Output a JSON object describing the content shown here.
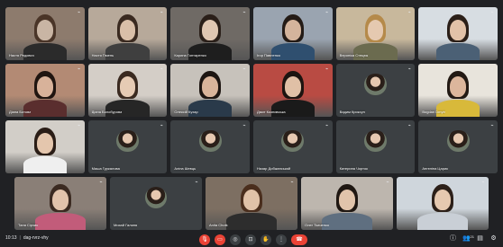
{
  "meeting": {
    "time": "10:13",
    "separator": "|",
    "code": "dag-rvrz-vhy",
    "participants_count": "21"
  },
  "participants": [
    {
      "name": "Настя Редович",
      "muted": true,
      "type": "video"
    },
    {
      "name": "Настя Гімень",
      "muted": true,
      "type": "video"
    },
    {
      "name": "Карина Гоптаренко",
      "muted": true,
      "type": "video"
    },
    {
      "name": "Ігор Павленко",
      "muted": true,
      "type": "video"
    },
    {
      "name": "Вероніка Стецюк",
      "muted": true,
      "type": "video"
    },
    {
      "name": "",
      "muted": true,
      "type": "video"
    },
    {
      "name": "Діана Ботова",
      "muted": true,
      "type": "video"
    },
    {
      "name": "Діана Болобурова",
      "muted": true,
      "type": "video"
    },
    {
      "name": "Олексій Кухар",
      "muted": true,
      "type": "video"
    },
    {
      "name": "Дмит Кознивська",
      "muted": true,
      "type": "video"
    },
    {
      "name": "Вадим Криксун",
      "muted": true,
      "type": "avatar"
    },
    {
      "name": "Bogdan Dmytr",
      "muted": true,
      "type": "video"
    },
    {
      "name": "",
      "muted": true,
      "type": "video"
    },
    {
      "name": "Маша Гуркалова",
      "muted": true,
      "type": "avatar"
    },
    {
      "name": "Аліна Шевць",
      "muted": true,
      "type": "avatar"
    },
    {
      "name": "Назар Добжанський",
      "muted": true,
      "type": "avatar"
    },
    {
      "name": "Катерина Чорток",
      "muted": true,
      "type": "avatar"
    },
    {
      "name": "Ангеліна Царик",
      "muted": true,
      "type": "avatar"
    },
    {
      "name": "Таня Сірчик",
      "muted": true,
      "type": "video"
    },
    {
      "name": "Михай Галиня",
      "muted": true,
      "type": "avatar"
    },
    {
      "name": "Anita Chotk",
      "muted": true,
      "type": "video"
    },
    {
      "name": "Олег Ткаченко",
      "muted": true,
      "type": "video"
    },
    {
      "name": "",
      "muted": true,
      "type": "video"
    }
  ],
  "controls": {
    "mic_icon": "mic-off-icon",
    "camera_icon": "camera-icon",
    "captions_icon": "captions-icon",
    "present_icon": "present-icon",
    "raise_hand_icon": "hand-icon",
    "more_icon": "more-icon",
    "end_call_icon": "end-call-icon",
    "mic_glyph": "🎙",
    "camera_glyph": "▭",
    "captions_glyph": "◎",
    "present_glyph": "⊡",
    "hand_glyph": "✋",
    "more_glyph": "⋮",
    "end_glyph": "☎"
  },
  "right_controls": {
    "info_glyph": "ⓘ",
    "people_glyph": "👥",
    "people_count": "21",
    "chat_glyph": "▤",
    "activities_glyph": "⚙"
  },
  "colors": {
    "background": "#202124",
    "tile": "#3c4043",
    "danger": "#ea4335"
  }
}
